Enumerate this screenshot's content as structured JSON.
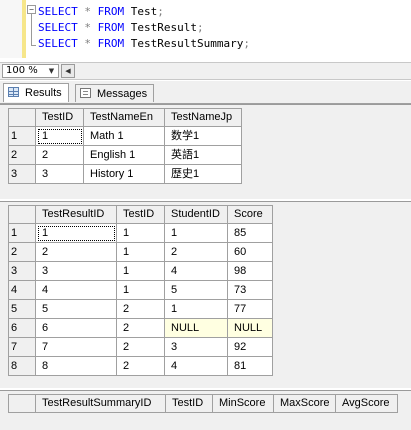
{
  "editor": {
    "lines": [
      {
        "k1": "SELECT",
        "star": "*",
        "k2": "FROM",
        "table": "Test",
        "semi": ";"
      },
      {
        "k1": "SELECT",
        "star": "*",
        "k2": "FROM",
        "table": "TestResult",
        "semi": ";"
      },
      {
        "k1": "SELECT",
        "star": "*",
        "k2": "FROM",
        "table": "TestResultSummary",
        "semi": ";"
      }
    ],
    "collapse_glyph": "−"
  },
  "zoom": {
    "value": "100 %",
    "arrow": "▼",
    "scroll_left": "◀"
  },
  "tabs": [
    {
      "label": "Results",
      "icon": "grid-icon",
      "active": true
    },
    {
      "label": "Messages",
      "icon": "messages-icon",
      "active": false
    }
  ],
  "grid1": {
    "columns": [
      "TestID",
      "TestNameEn",
      "TestNameJp"
    ],
    "rows": [
      {
        "num": "1",
        "cells": [
          "1",
          "Math 1",
          "数学1"
        ]
      },
      {
        "num": "2",
        "cells": [
          "2",
          "English 1",
          "英語1"
        ]
      },
      {
        "num": "3",
        "cells": [
          "3",
          "History 1",
          "歴史1"
        ]
      }
    ]
  },
  "grid2": {
    "columns": [
      "TestResultID",
      "TestID",
      "StudentID",
      "Score"
    ],
    "rows": [
      {
        "num": "1",
        "cells": [
          "1",
          "1",
          "1",
          "85"
        ]
      },
      {
        "num": "2",
        "cells": [
          "2",
          "1",
          "2",
          "60"
        ]
      },
      {
        "num": "3",
        "cells": [
          "3",
          "1",
          "4",
          "98"
        ]
      },
      {
        "num": "4",
        "cells": [
          "4",
          "1",
          "5",
          "73"
        ]
      },
      {
        "num": "5",
        "cells": [
          "5",
          "2",
          "1",
          "77"
        ]
      },
      {
        "num": "6",
        "cells": [
          "6",
          "2",
          "NULL",
          "NULL"
        ]
      },
      {
        "num": "7",
        "cells": [
          "7",
          "2",
          "3",
          "92"
        ]
      },
      {
        "num": "8",
        "cells": [
          "8",
          "2",
          "4",
          "81"
        ]
      }
    ]
  },
  "grid3": {
    "columns": [
      "TestResultSummaryID",
      "TestID",
      "MinScore",
      "MaxScore",
      "AvgScore"
    ],
    "rows": []
  },
  "colors": {
    "null_cell": "#ffffe1",
    "gutter_bar": "#f6e68a",
    "keyword": "#0000ff",
    "operator": "#808080"
  }
}
